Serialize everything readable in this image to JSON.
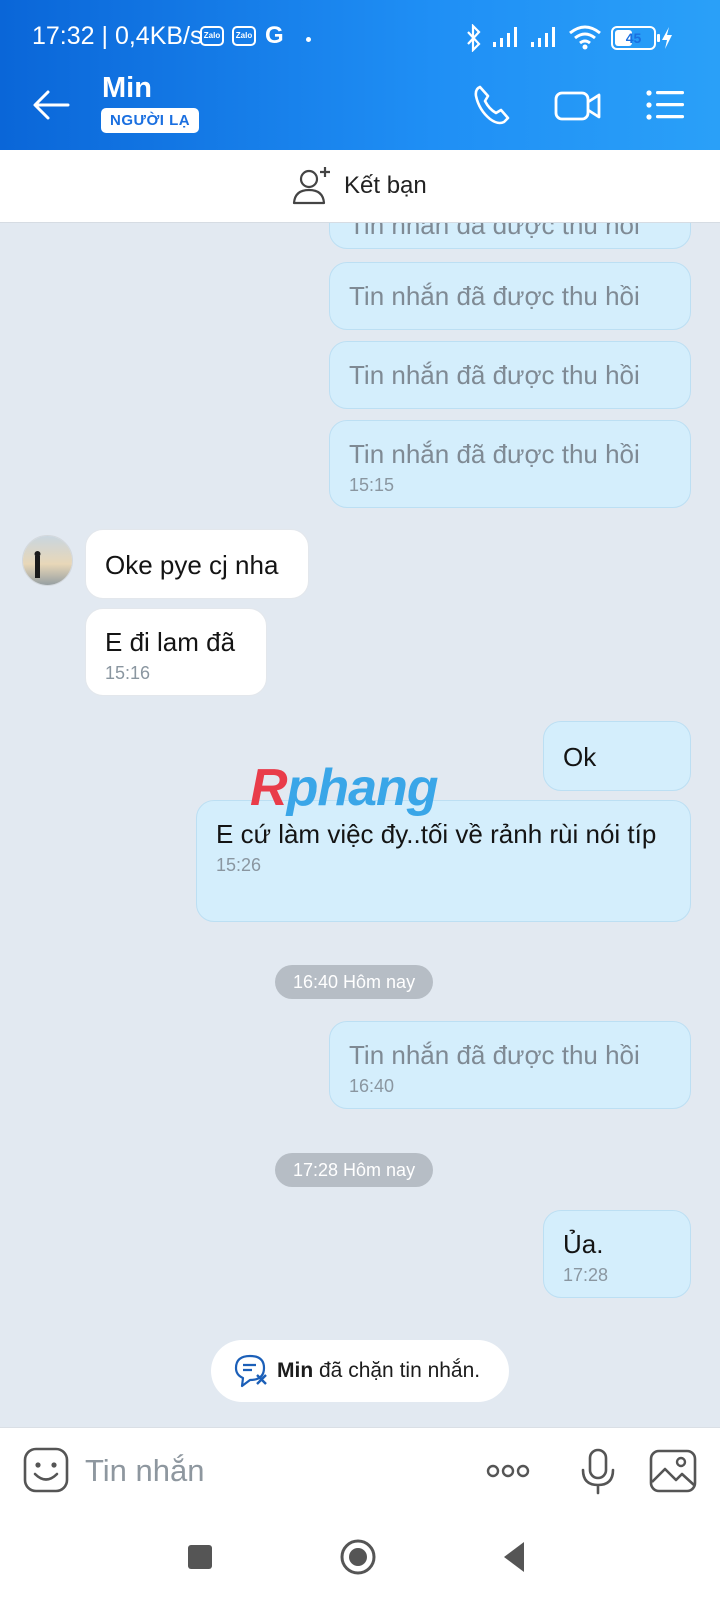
{
  "status": {
    "time": "17:32",
    "speed": "| 0,4KB/s",
    "notif_zalo": "Zalo",
    "notif_g": "G",
    "battery": "45",
    "battery_level": 0.45
  },
  "header": {
    "name": "Min",
    "badge": "NGƯỜI LẠ"
  },
  "add_friend": {
    "label": "Kết bạn"
  },
  "messages": [
    {
      "side": "sent",
      "text": "Tin nhắn đã được thu hồi",
      "recalled": true,
      "time": ""
    },
    {
      "side": "sent",
      "text": "Tin nhắn đã được thu hồi",
      "recalled": true,
      "time": ""
    },
    {
      "side": "sent",
      "text": "Tin nhắn đã được thu hồi",
      "recalled": true,
      "time": ""
    },
    {
      "side": "sent",
      "text": "Tin nhắn đã được thu hồi",
      "recalled": true,
      "time": "15:15"
    },
    {
      "side": "recv",
      "text": "Oke pye cj nha",
      "time": ""
    },
    {
      "side": "recv",
      "text": "E đi lam đã",
      "time": "15:16"
    },
    {
      "side": "sent",
      "text": "Ok",
      "time": ""
    },
    {
      "side": "sent",
      "text": "E cứ làm việc đy..tối về rảnh rùi nói típ",
      "time": "15:26"
    },
    {
      "side": "sent",
      "text": "Tin nhắn đã được thu hồi",
      "recalled": true,
      "time": "16:40"
    },
    {
      "side": "sent",
      "text": "Ủa.",
      "time": "17:28"
    }
  ],
  "separators": [
    "16:40 Hôm nay",
    "17:28 Hôm nay"
  ],
  "watermark": {
    "part1": "R",
    "part2": "phang"
  },
  "blocked": {
    "name": "Min",
    "text": "đã chặn tin nhắn."
  },
  "input": {
    "placeholder": "Tin nhắn"
  },
  "colors": {
    "header": "#1a7fe8",
    "sent_bubble": "#d4eefc",
    "chat_bg": "#e2e9f1"
  }
}
